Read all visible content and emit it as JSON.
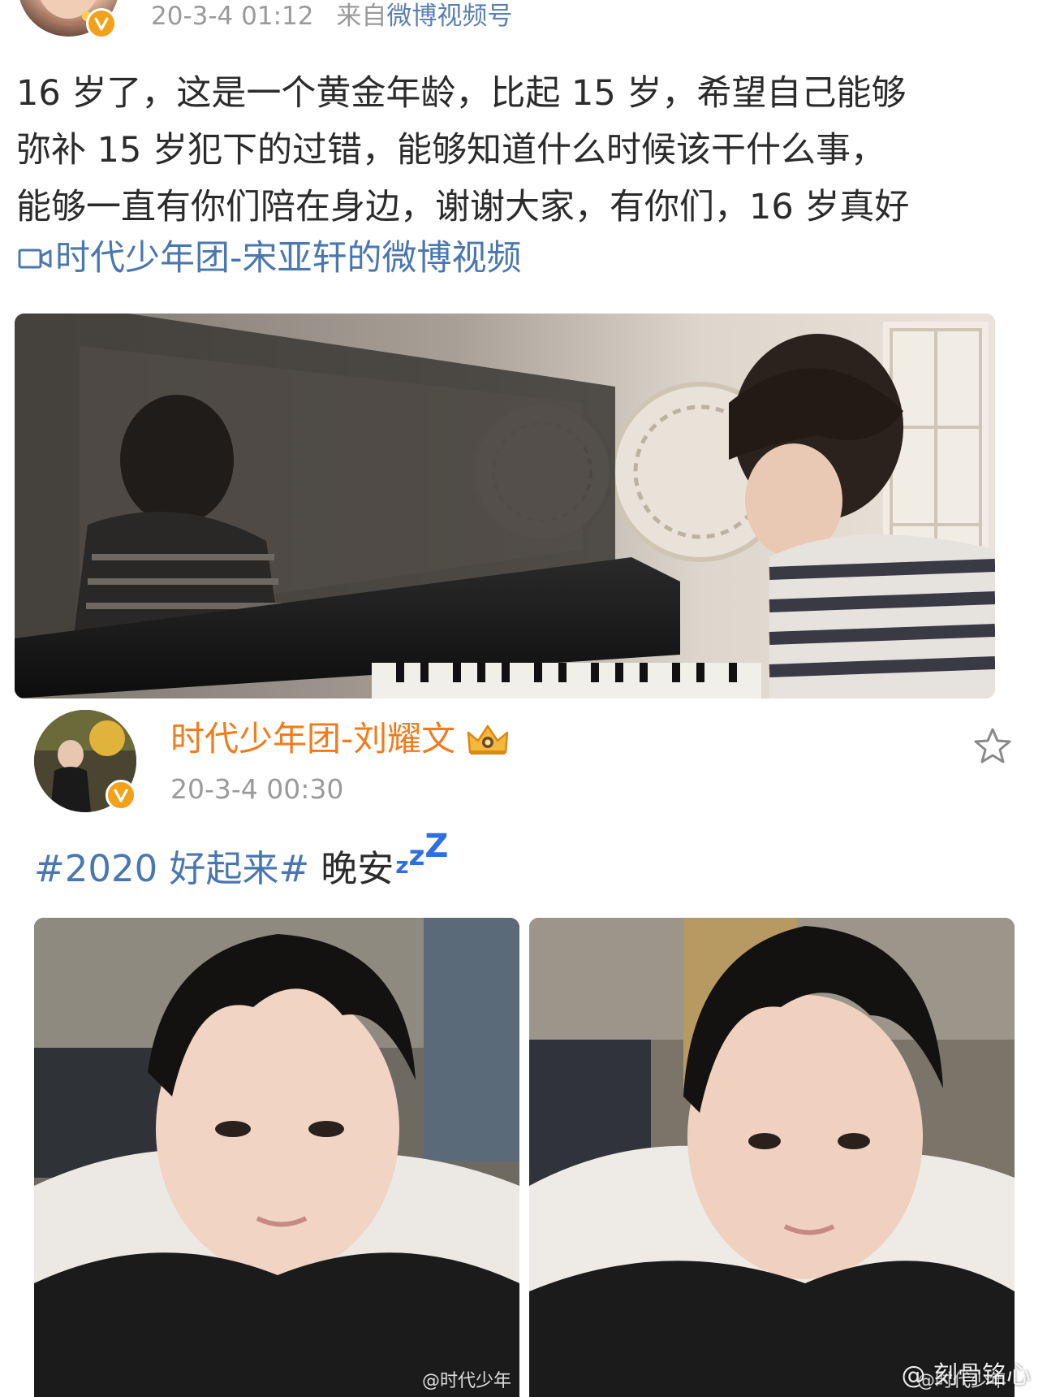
{
  "post1": {
    "time": "20-3-4 01:12",
    "source_prefix": "来自",
    "source_name": "微博视频号",
    "lines": [
      "16 岁了，这是一个黄金年龄，比起 15 岁，希望自己能够",
      "弥补 15 岁犯下的过错，能够知道什么时候该干什么事，",
      "能够一直有你们陪在身边，谢谢大家，有你们，16 岁真好"
    ],
    "video_link": "时代少年团-宋亚轩的微博视频",
    "video_icon": "video-camera-icon"
  },
  "post2": {
    "author": "时代少年团-刘耀文",
    "time": "20-3-4 00:30",
    "hashtag": "#2020 好起来#",
    "text": "晚安",
    "emoji": "zzz",
    "photo_watermark": "@时代少年",
    "corner_watermark": "@ 刻骨铭心"
  },
  "colors": {
    "link": "#4a77b0",
    "author_name": "#f27b1c",
    "meta": "#9a9a9a",
    "verified": "#f4a11a",
    "body_text": "#2b2b2b"
  }
}
